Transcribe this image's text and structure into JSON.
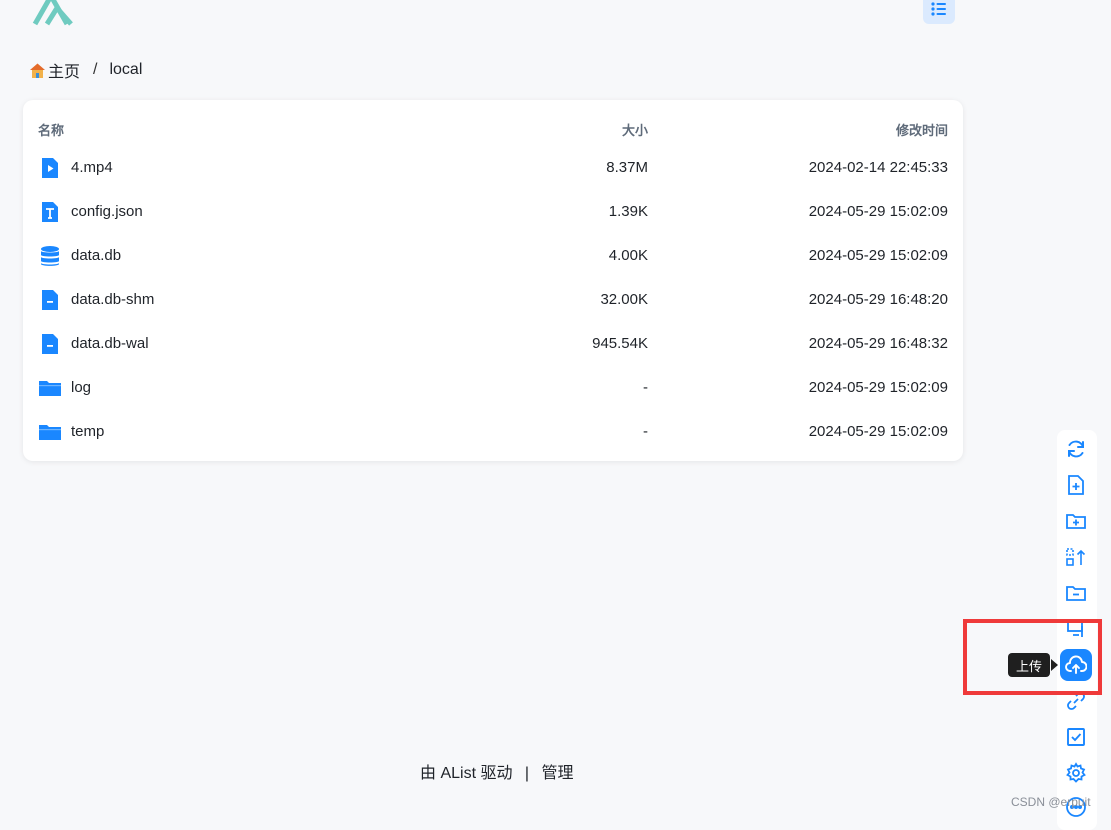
{
  "colors": {
    "accent": "#1a87ff",
    "highlight": "#ef3a3a"
  },
  "breadcrumb": {
    "home": "主页",
    "separator": "/",
    "current": "local"
  },
  "table": {
    "headers": {
      "name": "名称",
      "size": "大小",
      "modified": "修改时间"
    },
    "rows": [
      {
        "icon": "video-file-icon",
        "name": "4.mp4",
        "size": "8.37M",
        "modified": "2024-02-14 22:45:33"
      },
      {
        "icon": "text-file-icon",
        "name": "config.json",
        "size": "1.39K",
        "modified": "2024-05-29 15:02:09"
      },
      {
        "icon": "database-icon",
        "name": "data.db",
        "size": "4.00K",
        "modified": "2024-05-29 15:02:09"
      },
      {
        "icon": "file-icon",
        "name": "data.db-shm",
        "size": "32.00K",
        "modified": "2024-05-29 16:48:20"
      },
      {
        "icon": "file-icon",
        "name": "data.db-wal",
        "size": "945.54K",
        "modified": "2024-05-29 16:48:32"
      },
      {
        "icon": "folder-icon",
        "name": "log",
        "size": "-",
        "modified": "2024-05-29 15:02:09"
      },
      {
        "icon": "folder-icon",
        "name": "temp",
        "size": "-",
        "modified": "2024-05-29 15:02:09"
      }
    ]
  },
  "footer": {
    "powered_by": "由 AList 驱动",
    "divider": "|",
    "admin": "管理"
  },
  "toolbar": {
    "icons": [
      "refresh-icon",
      "new-file-icon",
      "new-folder-icon",
      "recursive-move-icon",
      "remove-empty-folder-icon",
      "batch-rename-icon",
      "upload-icon",
      "offline-download-icon",
      "select-icon",
      "settings-icon",
      "more-icon"
    ],
    "tooltip": "上传"
  },
  "watermark": "CSDN @erpuit"
}
